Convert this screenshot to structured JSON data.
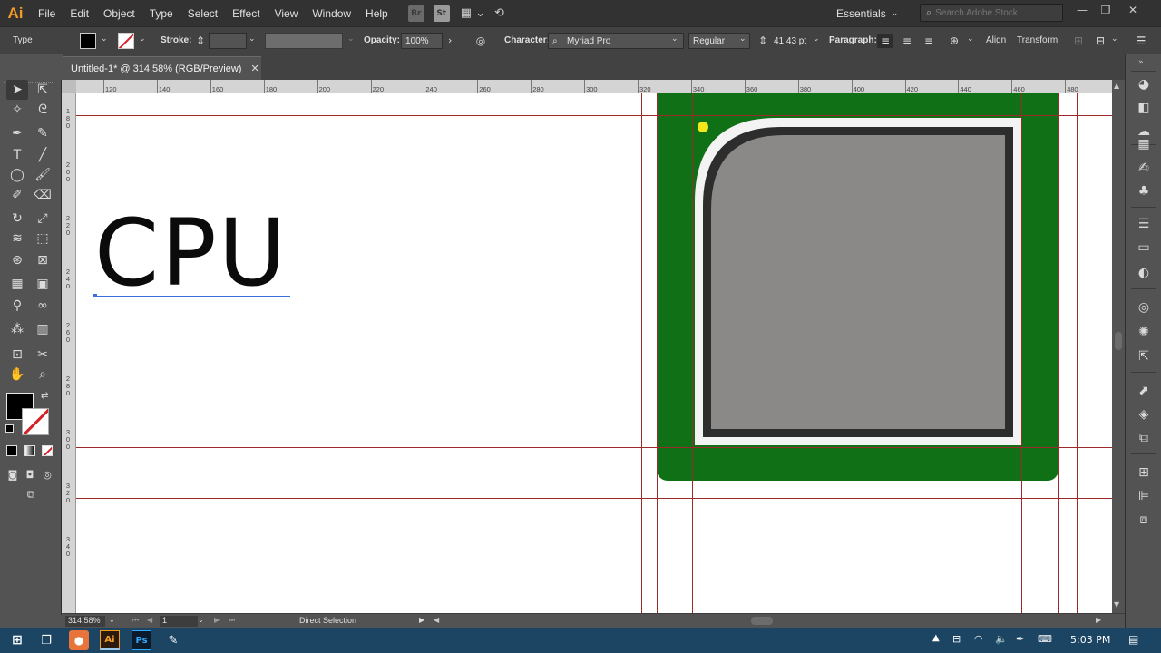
{
  "app": {
    "logo": "Ai",
    "menus": [
      "File",
      "Edit",
      "Object",
      "Type",
      "Select",
      "Effect",
      "View",
      "Window",
      "Help"
    ],
    "bridge_label": "Br",
    "stock_label": "St",
    "workspace": "Essentials",
    "search_placeholder": "Search Adobe Stock"
  },
  "control_bar": {
    "tool_name": "Type",
    "stroke_label": "Stroke:",
    "opacity_label": "Opacity:",
    "opacity_value": "100%",
    "character_label": "Character:",
    "font_family": "Myriad Pro",
    "font_style": "Regular",
    "font_size": "41.43 pt",
    "paragraph_label": "Paragraph:",
    "align_label": "Align",
    "transform_label": "Transform"
  },
  "document": {
    "tab_title": "Untitled-1* @ 314.58% (RGB/Preview)",
    "close_glyph": "✕"
  },
  "ruler": {
    "h_ticks": [
      "120",
      "140",
      "160",
      "180",
      "200",
      "220",
      "240",
      "260",
      "280",
      "300",
      "320",
      "340",
      "360",
      "380",
      "400",
      "420",
      "440",
      "460",
      "480"
    ],
    "v_ticks": [
      "180",
      "200",
      "220",
      "240",
      "260",
      "280",
      "300",
      "320",
      "340"
    ]
  },
  "canvas": {
    "text": "CPU",
    "colors": {
      "board": "#107016",
      "frame": "#f3f3f3",
      "die_border": "#2d2d2d",
      "die_fill": "#8b8988",
      "marker": "#f5e51b",
      "guides": "#9b2b2b"
    }
  },
  "status_bar": {
    "zoom": "314.58%",
    "artboard": "1",
    "tool": "Direct Selection"
  },
  "taskbar": {
    "time": "5:03 PM",
    "apps": [
      "Ai",
      "Ps"
    ]
  }
}
